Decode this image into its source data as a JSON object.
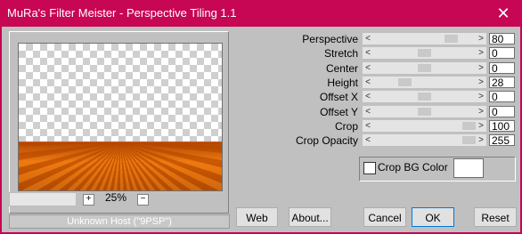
{
  "window": {
    "title": "MuRa's Filter Meister - Perspective Tiling 1.1",
    "close_glyph": "✕"
  },
  "zoom": {
    "plus": "+",
    "value": "25%",
    "minus": "−"
  },
  "status_text": "Unknown Host (\"9PSP\")",
  "params": [
    {
      "label": "Perspective",
      "value": "80",
      "level": 0.8
    },
    {
      "label": "Stretch",
      "value": "0",
      "level": 0.5
    },
    {
      "label": "Center",
      "value": "0",
      "level": 0.5
    },
    {
      "label": "Height",
      "value": "28",
      "level": 0.28
    },
    {
      "label": "Offset X",
      "value": "0",
      "level": 0.5
    },
    {
      "label": "Offset Y",
      "value": "0",
      "level": 0.5
    },
    {
      "label": "Crop",
      "value": "100",
      "level": 1.0
    },
    {
      "label": "Crop Opacity",
      "value": "255",
      "level": 1.0
    }
  ],
  "slider_arrows": {
    "left": "<",
    "right": ">"
  },
  "crop_bg": {
    "label": "Crop BG Color",
    "checked": false
  },
  "buttons": {
    "web": "Web",
    "about": "About...",
    "cancel": "Cancel",
    "ok": "OK",
    "reset": "Reset"
  },
  "colors": {
    "titlebar": "#c70654",
    "dialog": "#c0c0c0"
  }
}
